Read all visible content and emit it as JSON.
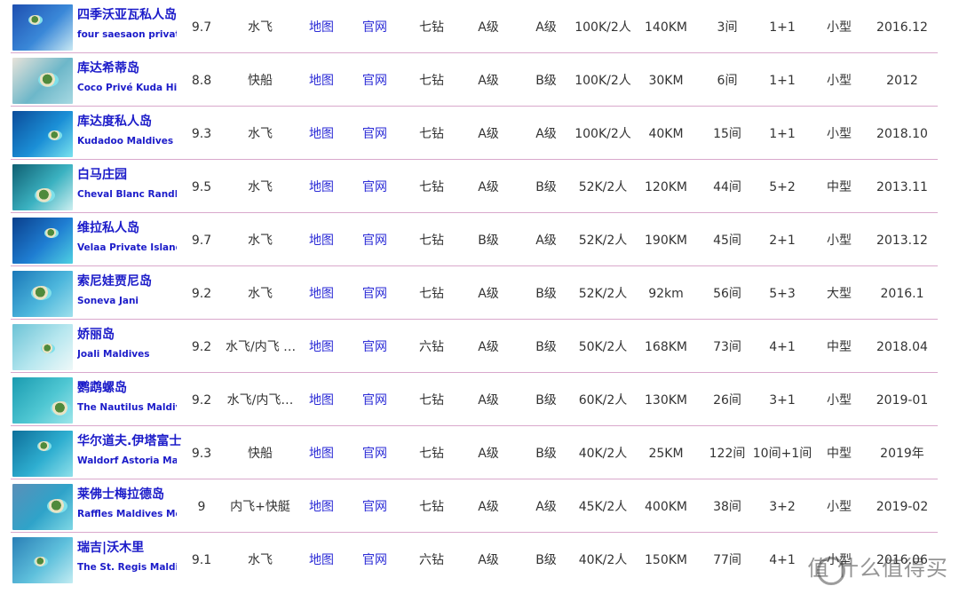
{
  "rows": [
    {
      "name": "四季沃亚瓦私人岛",
      "english": "four saesaon private i",
      "score": "9.7",
      "transfer": "水飞",
      "map": "地图",
      "site": "官网",
      "stars": "七钻",
      "grade1": "A级",
      "grade2": "A级",
      "price": "100K/2人",
      "distance": "140KM",
      "rooms": "3间",
      "config": "1+1",
      "size": "小型",
      "date": "2016.12",
      "thumb_colors": [
        "#1e4fb0",
        "#3a88d8",
        "#c9e9f3"
      ]
    },
    {
      "name": "库达希蒂岛",
      "english": "Coco Privé Kuda Hithi",
      "score": "8.8",
      "transfer": "快船",
      "map": "地图",
      "site": "官网",
      "stars": "七钻",
      "grade1": "A级",
      "grade2": "B级",
      "price": "100K/2人",
      "distance": "30KM",
      "rooms": "6间",
      "config": "1+1",
      "size": "小型",
      "date": "2012",
      "thumb_colors": [
        "#e8e3da",
        "#6db7c9",
        "#a7d9e2"
      ]
    },
    {
      "name": "库达度私人岛",
      "english": "Kudadoo Maldives",
      "score": "9.3",
      "transfer": "水飞",
      "map": "地图",
      "site": "官网",
      "stars": "七钻",
      "grade1": "A级",
      "grade2": "A级",
      "price": "100K/2人",
      "distance": "40KM",
      "rooms": "15间",
      "config": "1+1",
      "size": "小型",
      "date": "2018.10",
      "thumb_colors": [
        "#0b4c9a",
        "#1b8fd6",
        "#79e2ee"
      ]
    },
    {
      "name": "白马庄园",
      "english": "Cheval Blanc Randheli",
      "score": "9.5",
      "transfer": "水飞",
      "map": "地图",
      "site": "官网",
      "stars": "七钻",
      "grade1": "A级",
      "grade2": "B级",
      "price": "52K/2人",
      "distance": "120KM",
      "rooms": "44间",
      "config": "5+2",
      "size": "中型",
      "date": "2013.11",
      "thumb_colors": [
        "#0f5f72",
        "#3bb2c1",
        "#cdeff0"
      ]
    },
    {
      "name": "维拉私人岛",
      "english": "Velaa Private Island",
      "score": "9.7",
      "transfer": "水飞",
      "map": "地图",
      "site": "官网",
      "stars": "七钻",
      "grade1": "B级",
      "grade2": "A级",
      "price": "52K/2人",
      "distance": "190KM",
      "rooms": "45间",
      "config": "2+1",
      "size": "小型",
      "date": "2013.12",
      "thumb_colors": [
        "#0a3f8c",
        "#1f7ed2",
        "#4fd0e2"
      ]
    },
    {
      "name": "索尼娃贾尼岛",
      "english": "Soneva Jani",
      "score": "9.2",
      "transfer": "水飞",
      "map": "地图",
      "site": "官网",
      "stars": "七钻",
      "grade1": "A级",
      "grade2": "B级",
      "price": "52K/2人",
      "distance": "92km",
      "rooms": "56间",
      "config": "5+3",
      "size": "大型",
      "date": "2016.1",
      "thumb_colors": [
        "#1a77b8",
        "#4cb6dc",
        "#9fe0ec"
      ]
    },
    {
      "name": "娇丽岛",
      "english": "Joali Maldives",
      "score": "9.2",
      "transfer": "水飞/内飞 …",
      "map": "地图",
      "site": "官网",
      "stars": "六钻",
      "grade1": "A级",
      "grade2": "B级",
      "price": "50K/2人",
      "distance": "168KM",
      "rooms": "73间",
      "config": "4+1",
      "size": "中型",
      "date": "2018.04",
      "thumb_colors": [
        "#6cc3d6",
        "#b7e7ef",
        "#eef8f8"
      ]
    },
    {
      "name": "鹦鹉螺岛",
      "english": "The Nautilus Maldives",
      "score": "9.2",
      "transfer": "水飞/内飞…",
      "map": "地图",
      "site": "官网",
      "stars": "七钻",
      "grade1": "A级",
      "grade2": "B级",
      "price": "60K/2人",
      "distance": "130KM",
      "rooms": "26间",
      "config": "3+1",
      "size": "小型",
      "date": "2019-01",
      "thumb_colors": [
        "#1a9bb0",
        "#4ec6d2",
        "#9ee6ea"
      ]
    },
    {
      "name": "华尔道夫.伊塔富士",
      "english": "Waldorf Astoria Maldives",
      "score": "9.3",
      "transfer": "快船",
      "map": "地图",
      "site": "官网",
      "stars": "七钻",
      "grade1": "A级",
      "grade2": "B级",
      "price": "40K/2人",
      "distance": "25KM",
      "rooms": "122间",
      "config": "10间+1间",
      "size": "中型",
      "date": "2019年",
      "thumb_colors": [
        "#0e6f9a",
        "#2eaed0",
        "#8fe0ea"
      ]
    },
    {
      "name": "莱佛士梅拉德岛",
      "english": "Raffles Maldives Meradhoo",
      "score": "9",
      "transfer": "内飞+快艇",
      "map": "地图",
      "site": "官网",
      "stars": "七钻",
      "grade1": "A级",
      "grade2": "A级",
      "price": "45K/2人",
      "distance": "400KM",
      "rooms": "38间",
      "config": "3+2",
      "size": "小型",
      "date": "2019-02",
      "thumb_colors": [
        "#5a8fb8",
        "#2fa3c9",
        "#7fd7e4"
      ]
    },
    {
      "name": "瑞吉|沃木里",
      "english": "The St. Regis Maldives",
      "score": "9.1",
      "transfer": "水飞",
      "map": "地图",
      "site": "官网",
      "stars": "六钻",
      "grade1": "A级",
      "grade2": "B级",
      "price": "40K/2人",
      "distance": "150KM",
      "rooms": "77间",
      "config": "4+1",
      "size": "小型",
      "date": "2016.06",
      "thumb_colors": [
        "#2a7fb6",
        "#5ec0dc",
        "#c3ecf2"
      ]
    }
  ],
  "watermark": "值 什么值得买",
  "colors": {
    "link": "#2b2bd6",
    "name": "#1b1bc9",
    "divider": "#d9a8cc"
  }
}
